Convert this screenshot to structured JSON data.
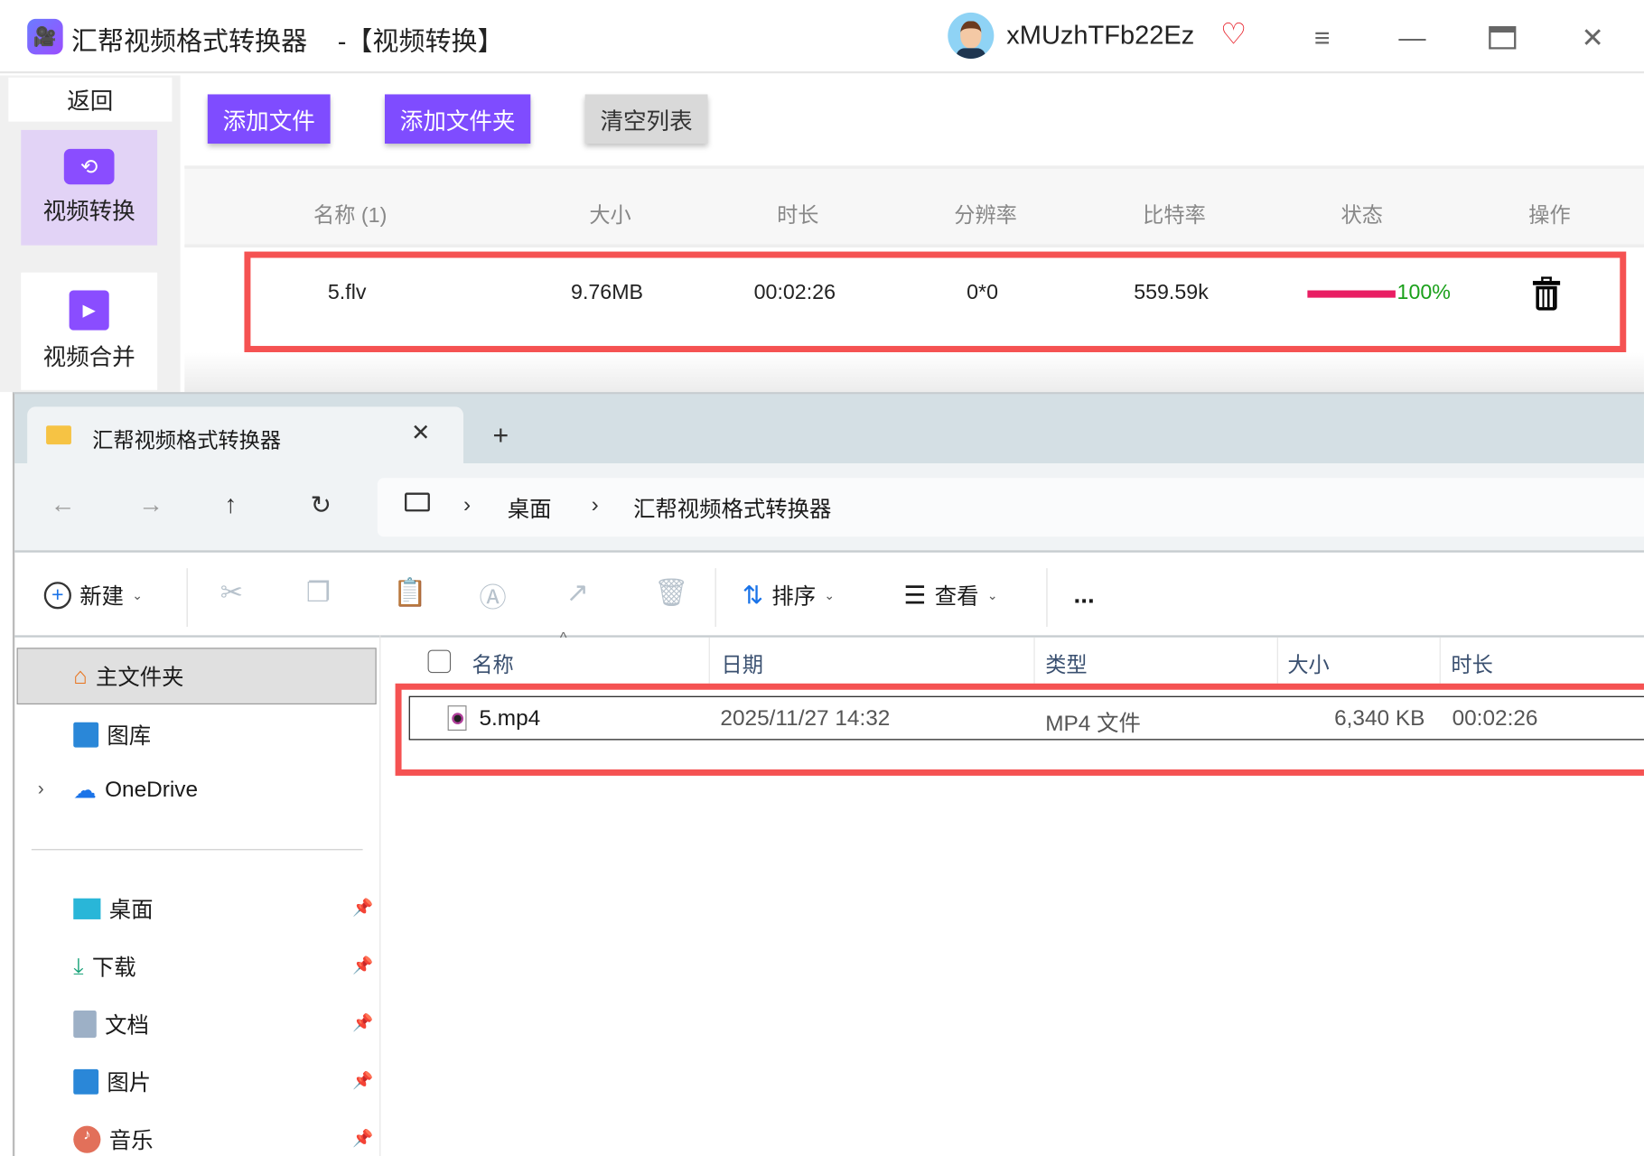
{
  "app": {
    "title": "汇帮视频格式转换器",
    "mode": "-【视频转换】",
    "username": "xMUzhTFb22Ez"
  },
  "sidebar": {
    "back": "返回",
    "items": [
      {
        "label": "视频转换"
      },
      {
        "label": "视频合并"
      }
    ]
  },
  "toolbar": {
    "add_file": "添加文件",
    "add_folder": "添加文件夹",
    "clear": "清空列表"
  },
  "table": {
    "headers": [
      "名称 (1)",
      "大小",
      "时长",
      "分辨率",
      "比特率",
      "状态",
      "操作"
    ],
    "rows": [
      {
        "name": "5.flv",
        "size": "9.76MB",
        "duration": "00:02:26",
        "resolution": "0*0",
        "bitrate": "559.59k",
        "progress": 100,
        "progress_label": "100%"
      }
    ]
  },
  "colors": {
    "accent": "#7f4cff",
    "progress": "#e91e63",
    "done": "#1aa01a",
    "highlight": "#f55252"
  },
  "explorer": {
    "tab_title": "汇帮视频格式转换器",
    "breadcrumb": [
      "桌面",
      "汇帮视频格式转换器"
    ],
    "commands": {
      "new": "新建",
      "sort": "排序",
      "view": "查看",
      "more": "..."
    },
    "nav": [
      {
        "label": "主文件夹"
      },
      {
        "label": "图库"
      },
      {
        "label": "OneDrive"
      },
      {
        "label": "桌面"
      },
      {
        "label": "下载"
      },
      {
        "label": "文档"
      },
      {
        "label": "图片"
      },
      {
        "label": "音乐"
      }
    ],
    "columns": [
      "名称",
      "日期",
      "类型",
      "大小",
      "时长"
    ],
    "files": [
      {
        "name": "5.mp4",
        "date": "2025/11/27 14:32",
        "type": "MP4 文件",
        "size": "6,340 KB",
        "duration": "00:02:26"
      }
    ]
  }
}
